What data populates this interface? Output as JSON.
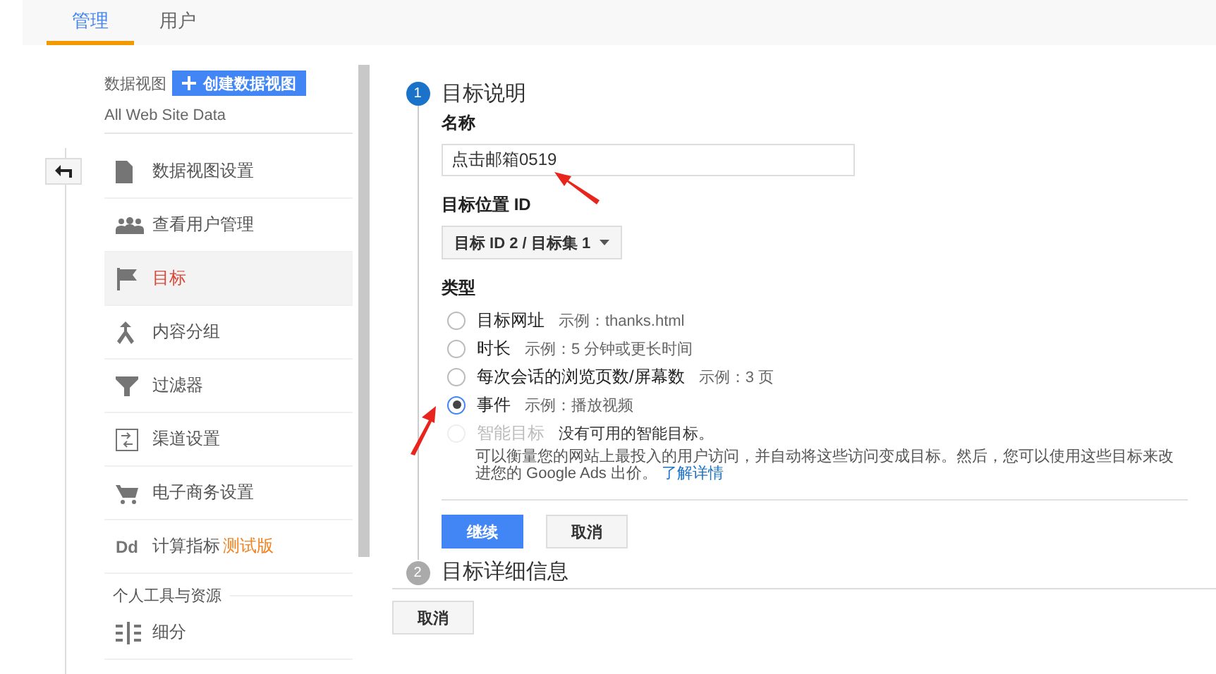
{
  "tabs": [
    {
      "label": "管理",
      "selected": true
    },
    {
      "label": "用户",
      "selected": false
    }
  ],
  "sidebar": {
    "view_label": "数据视图",
    "create_button": "创建数据视图",
    "view_name": "All Web Site Data",
    "items": [
      {
        "kind": "document",
        "label": "数据视图设置",
        "selected": false
      },
      {
        "kind": "people",
        "label": "查看用户管理",
        "selected": false
      },
      {
        "kind": "flag",
        "label": "目标",
        "selected": true
      },
      {
        "kind": "merge",
        "label": "内容分组",
        "selected": false
      },
      {
        "kind": "filter",
        "label": "过滤器",
        "selected": false
      },
      {
        "kind": "channel",
        "label": "渠道设置",
        "selected": false
      },
      {
        "kind": "cart",
        "label": "电子商务设置",
        "selected": false
      },
      {
        "kind": "dd",
        "icon_text": "Dd",
        "label": "计算指标",
        "badge": "测试版",
        "selected": false
      }
    ],
    "section_header": "个人工具与资源",
    "section_items": [
      {
        "kind": "segments",
        "label": "细分",
        "selected": false
      }
    ]
  },
  "step1": {
    "number": "1",
    "title": "目标说明",
    "name_label": "名称",
    "name_value": "点击邮箱0519",
    "position_label": "目标位置 ID",
    "position_value": "目标 ID 2 / 目标集 1",
    "type_label": "类型",
    "types": [
      {
        "label": "目标网址",
        "example": "示例：thanks.html",
        "selected": false,
        "disabled": false
      },
      {
        "label": "时长",
        "example": "示例：5 分钟或更长时间",
        "selected": false,
        "disabled": false
      },
      {
        "label": "每次会话的浏览页数/屏幕数",
        "example": "示例：3 页",
        "selected": false,
        "disabled": false
      },
      {
        "label": "事件",
        "example": "示例：播放视频",
        "selected": true,
        "disabled": false
      },
      {
        "label": "智能目标",
        "example": "没有可用的智能目标。",
        "selected": false,
        "disabled": true
      }
    ],
    "smart_description": "可以衡量您的网站上最投入的用户访问，并自动将这些访问变成目标。然后，您可以使用这些目标来改进您的 Google Ads 出价。",
    "learn_more": "了解详情",
    "continue_button": "继续",
    "cancel_button": "取消"
  },
  "step2": {
    "number": "2",
    "title": "目标详细信息"
  },
  "footer_cancel": "取消"
}
